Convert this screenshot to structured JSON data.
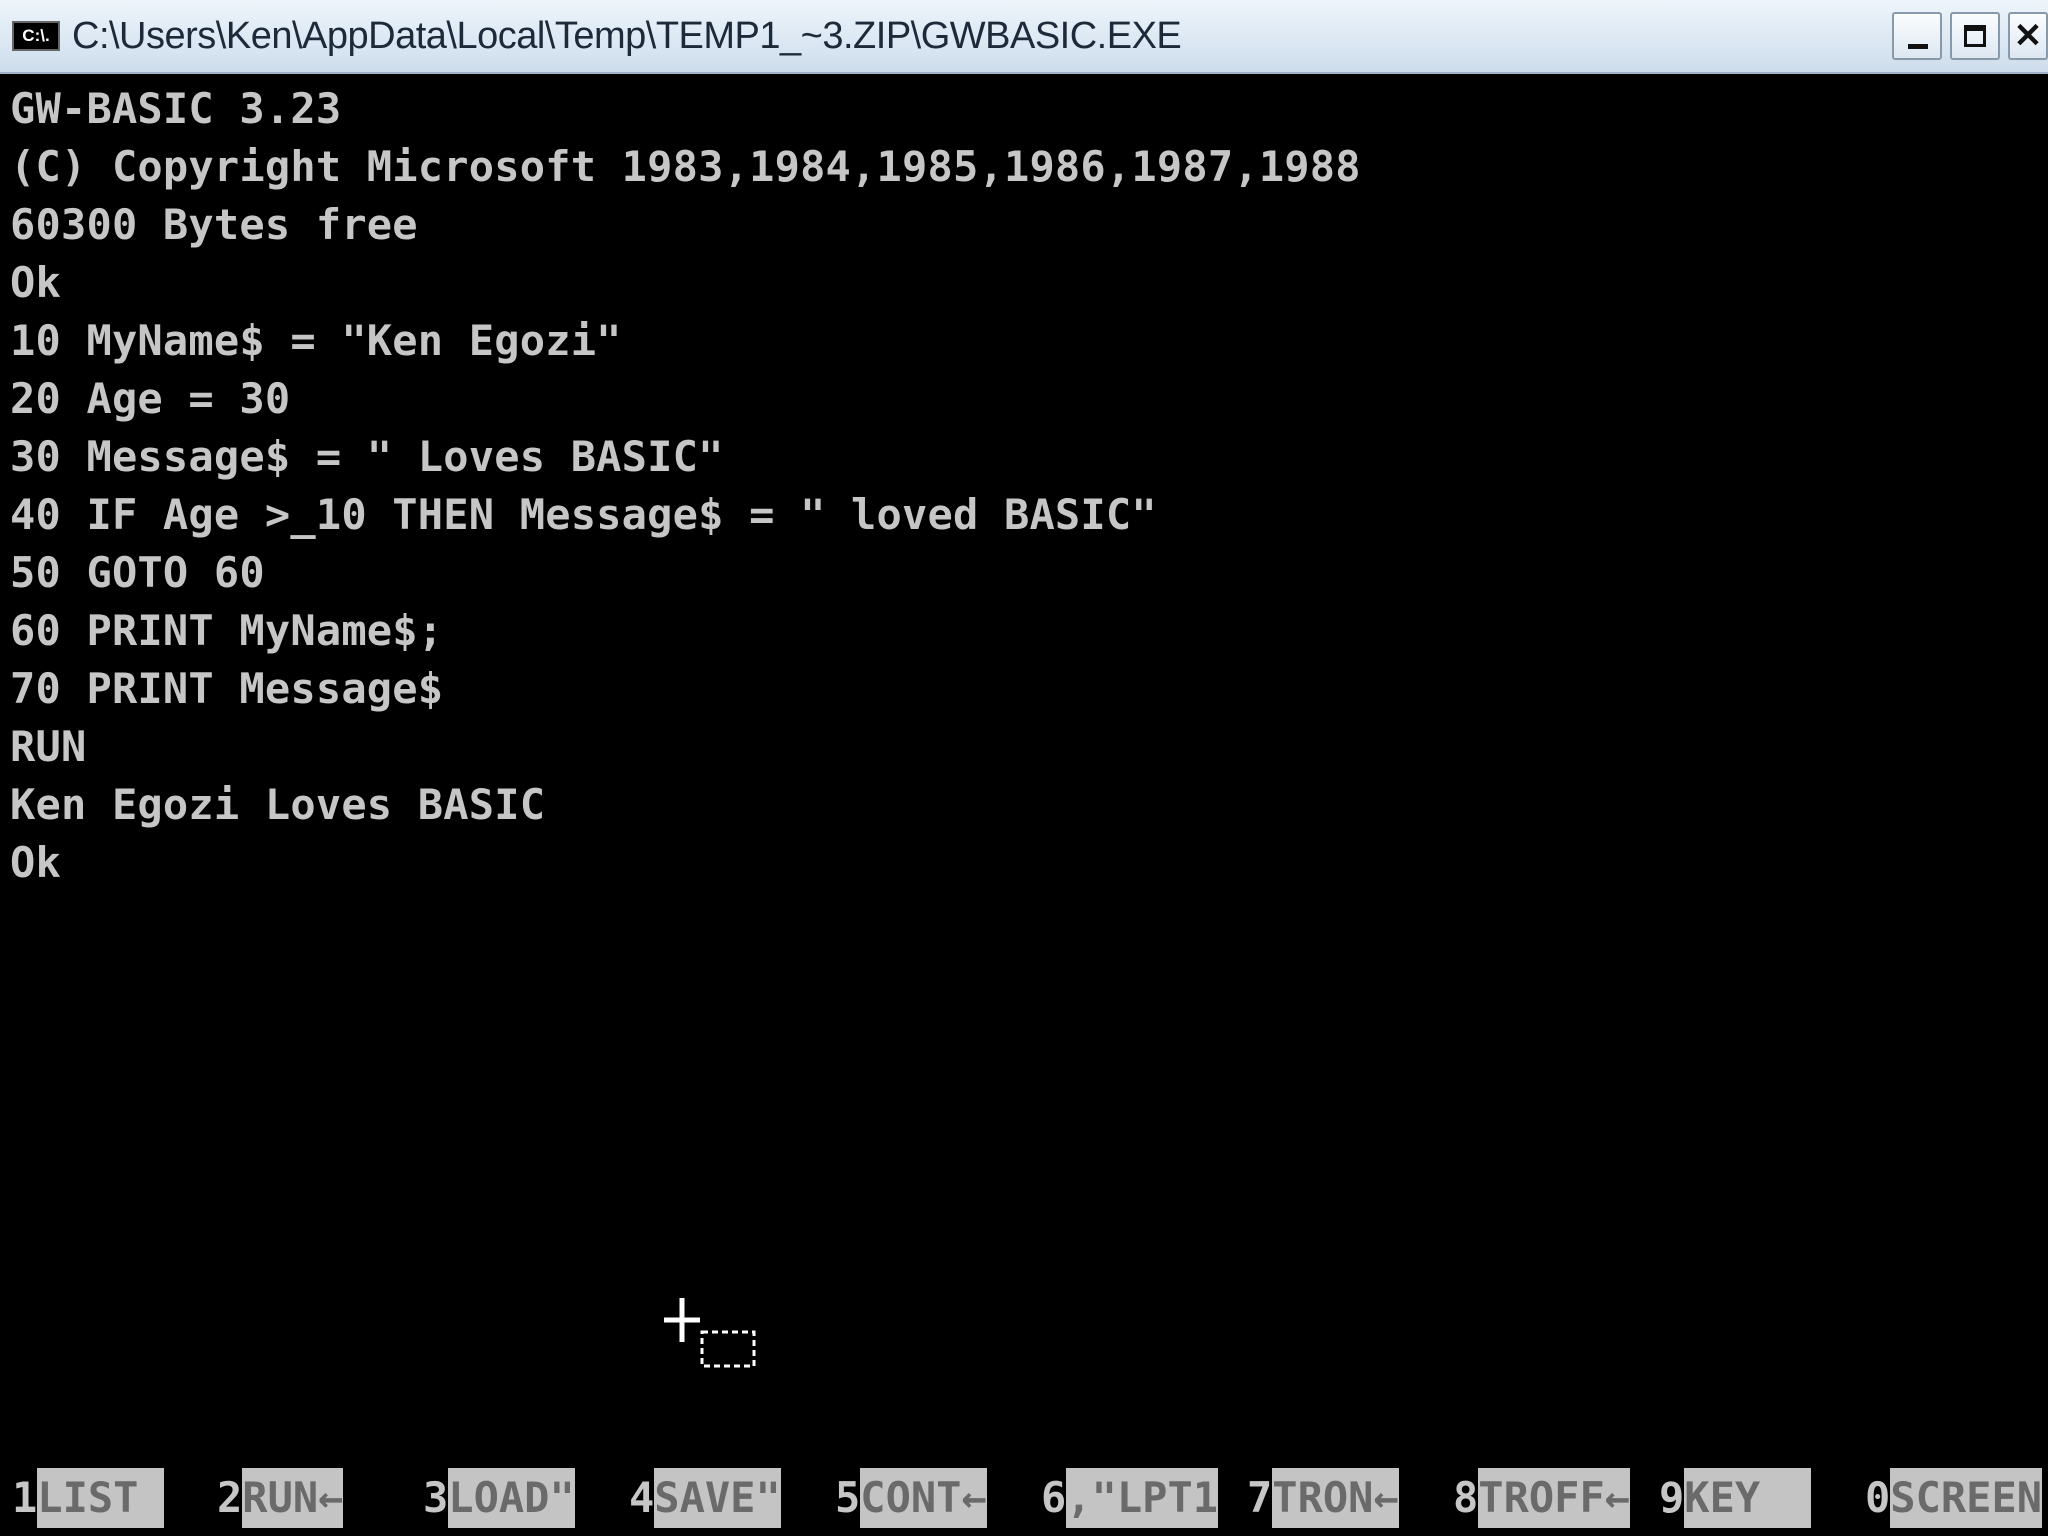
{
  "window": {
    "icon_label": "C:\\.",
    "title": "C:\\Users\\Ken\\AppData\\Local\\Temp\\TEMP1_~3.ZIP\\GWBASIC.EXE"
  },
  "console_lines": [
    "GW-BASIC 3.23",
    "(C) Copyright Microsoft 1983,1984,1985,1986,1987,1988",
    "60300 Bytes free",
    "Ok",
    "10 MyName$ = \"Ken Egozi\"",
    "20 Age = 30",
    "30 Message$ = \" Loves BASIC\"",
    "40 IF Age >_10 THEN Message$ = \" loved BASIC\"",
    "50 GOTO 60",
    "60 PRINT MyName$;",
    "70 PRINT Message$",
    "RUN",
    "Ken Egozi Loves BASIC",
    "Ok"
  ],
  "function_keys": [
    {
      "num": "1",
      "label": "LIST "
    },
    {
      "num": "2",
      "label": "RUN←"
    },
    {
      "num": "3",
      "label": "LOAD\""
    },
    {
      "num": "4",
      "label": "SAVE\""
    },
    {
      "num": "5",
      "label": "CONT←"
    },
    {
      "num": "6",
      "label": ",\"LPT1"
    },
    {
      "num": "7",
      "label": "TRON←"
    },
    {
      "num": "8",
      "label": "TROFF←"
    },
    {
      "num": "9",
      "label": "KEY  "
    },
    {
      "num": "0",
      "label": "SCREEN"
    }
  ],
  "colors": {
    "console_bg": "#000000",
    "console_text": "#c6c6c6",
    "keybar_label_bg": "#c4c4c4"
  },
  "icons": {
    "minimize": "minimize-icon",
    "maximize": "maximize-icon",
    "close": "close-icon",
    "mouse_cursor": "copy-drag-cursor-icon"
  }
}
